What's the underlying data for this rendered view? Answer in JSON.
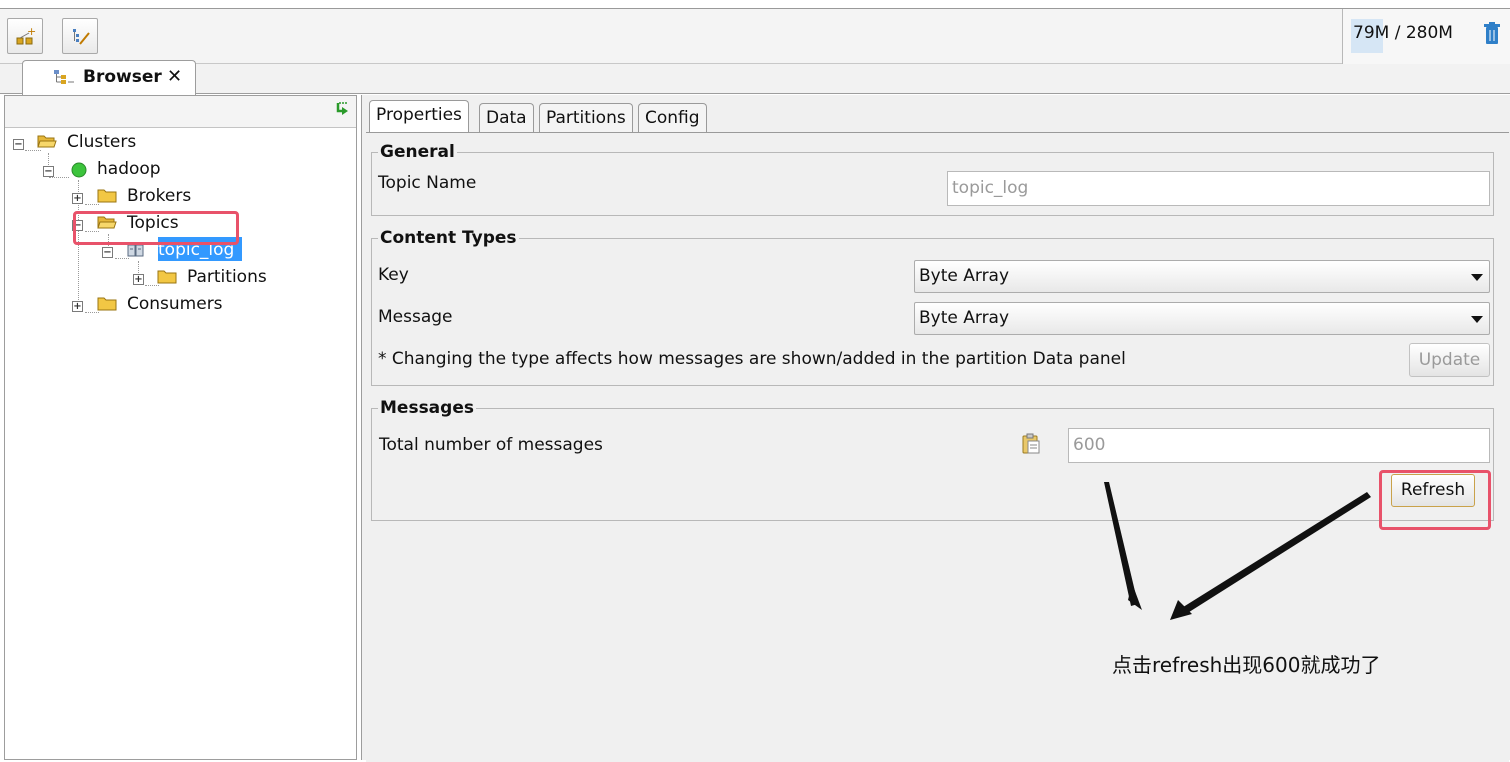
{
  "toolbar": {
    "memory_used": "79M",
    "memory_total": " / 280M"
  },
  "view_tab": {
    "label": "Browser",
    "close": "✕"
  },
  "tree": {
    "clusters": "Clusters",
    "cluster": "hadoop",
    "brokers": "Brokers",
    "topics": "Topics",
    "topic": "topic_log",
    "partitions": "Partitions",
    "consumers": "Consumers"
  },
  "tabs": [
    "Properties",
    "Data",
    "Partitions",
    "Config"
  ],
  "general": {
    "title": "General",
    "topic_name_label": "Topic Name",
    "topic_name_value": "topic_log"
  },
  "content_types": {
    "title": "Content Types",
    "key_label": "Key",
    "key_value": "Byte Array",
    "message_label": "Message",
    "message_value": "Byte Array",
    "note": "* Changing the type affects how messages are shown/added in the partition Data panel",
    "update_button": "Update"
  },
  "messages": {
    "title": "Messages",
    "total_label": "Total number of messages",
    "total_value": "600",
    "refresh_button": "Refresh"
  },
  "annotation": {
    "text": "点击refresh出现600就成功了"
  },
  "colors": {
    "selection": "#3399ff",
    "highlight": "#e8526a",
    "online": "#3cc43c"
  }
}
